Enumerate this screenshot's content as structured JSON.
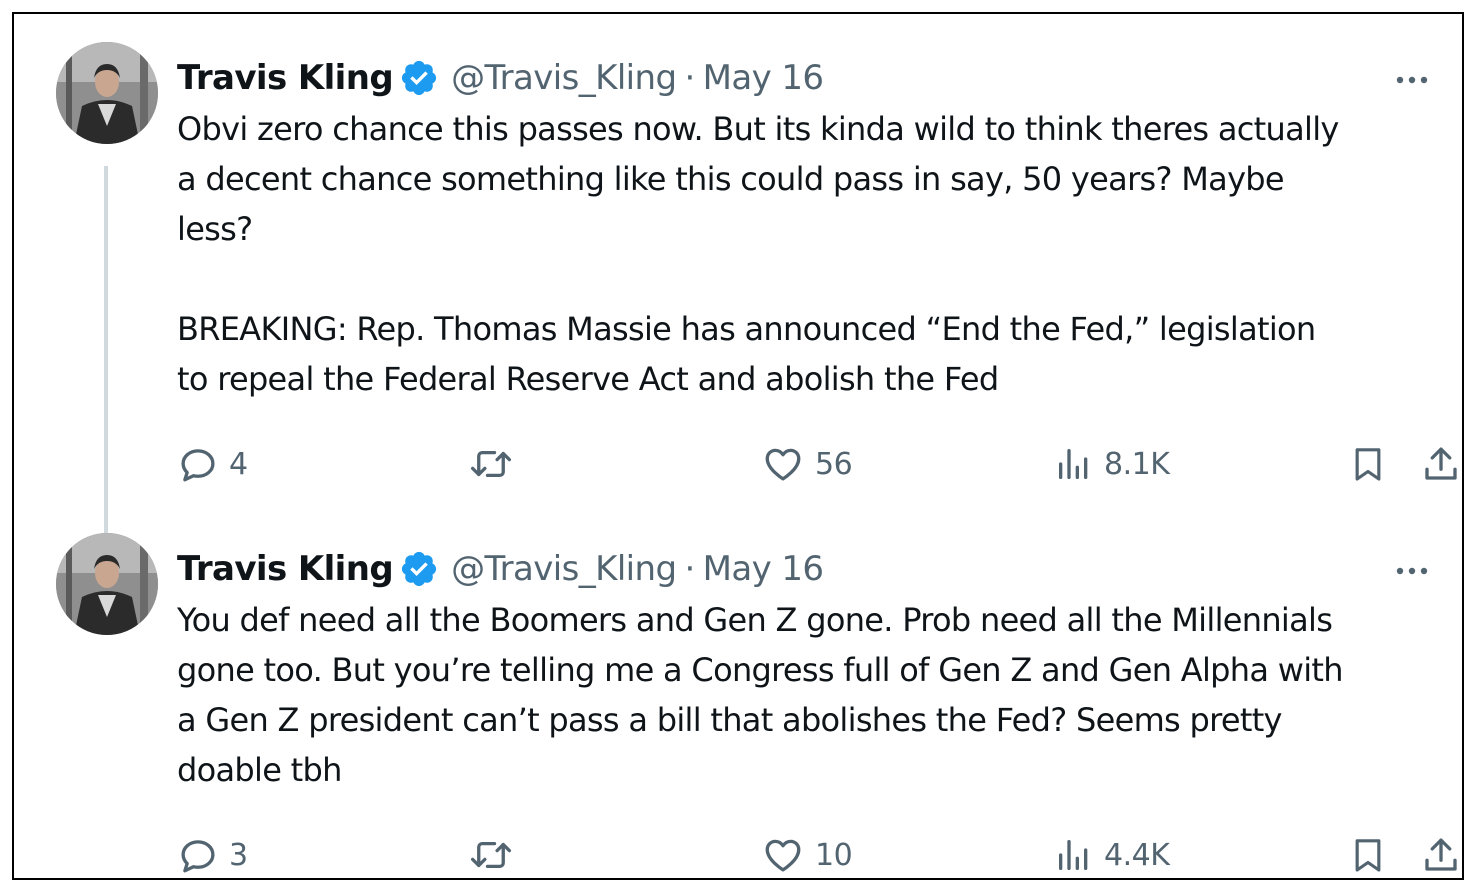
{
  "tweets": [
    {
      "author": {
        "name": "Travis Kling",
        "handle": "@Travis_Kling",
        "verified": true
      },
      "separator": "·",
      "date": "May 16",
      "text_lines": [
        "Obvi zero chance this passes now. But its kinda wild to think theres actually",
        "a decent chance something like this could pass in say, 50 years? Maybe",
        "less?",
        "",
        "BREAKING: Rep. Thomas Massie has announced “End the Fed,” legislation",
        "to repeal the Federal Reserve Act and abolish the Fed"
      ],
      "stats": {
        "replies": "4",
        "likes": "56",
        "views": "8.1K"
      }
    },
    {
      "author": {
        "name": "Travis Kling",
        "handle": "@Travis_Kling",
        "verified": true
      },
      "separator": "·",
      "date": "May 16",
      "text_lines": [
        "You def need all the Boomers and Gen Z gone. Prob need all the Millennials",
        "gone too. But you’re telling me a Congress full of Gen Z and Gen Alpha with",
        "a Gen Z president can’t pass a bill that abolishes the Fed? Seems pretty",
        "doable tbh"
      ],
      "stats": {
        "replies": "3",
        "likes": "10",
        "views": "4.4K"
      }
    }
  ],
  "icons": {
    "verified": "verified-badge-icon",
    "more": "more-dots-icon",
    "reply": "reply-icon",
    "retweet": "retweet-icon",
    "like": "heart-icon",
    "views": "views-bar-chart-icon",
    "bookmark": "bookmark-icon",
    "share": "share-upload-icon"
  },
  "colors": {
    "text_primary": "#0f1419",
    "text_secondary": "#536471",
    "verified_blue": "#1d9bf0",
    "thread_line": "#cfd9de",
    "border": "#000000"
  }
}
